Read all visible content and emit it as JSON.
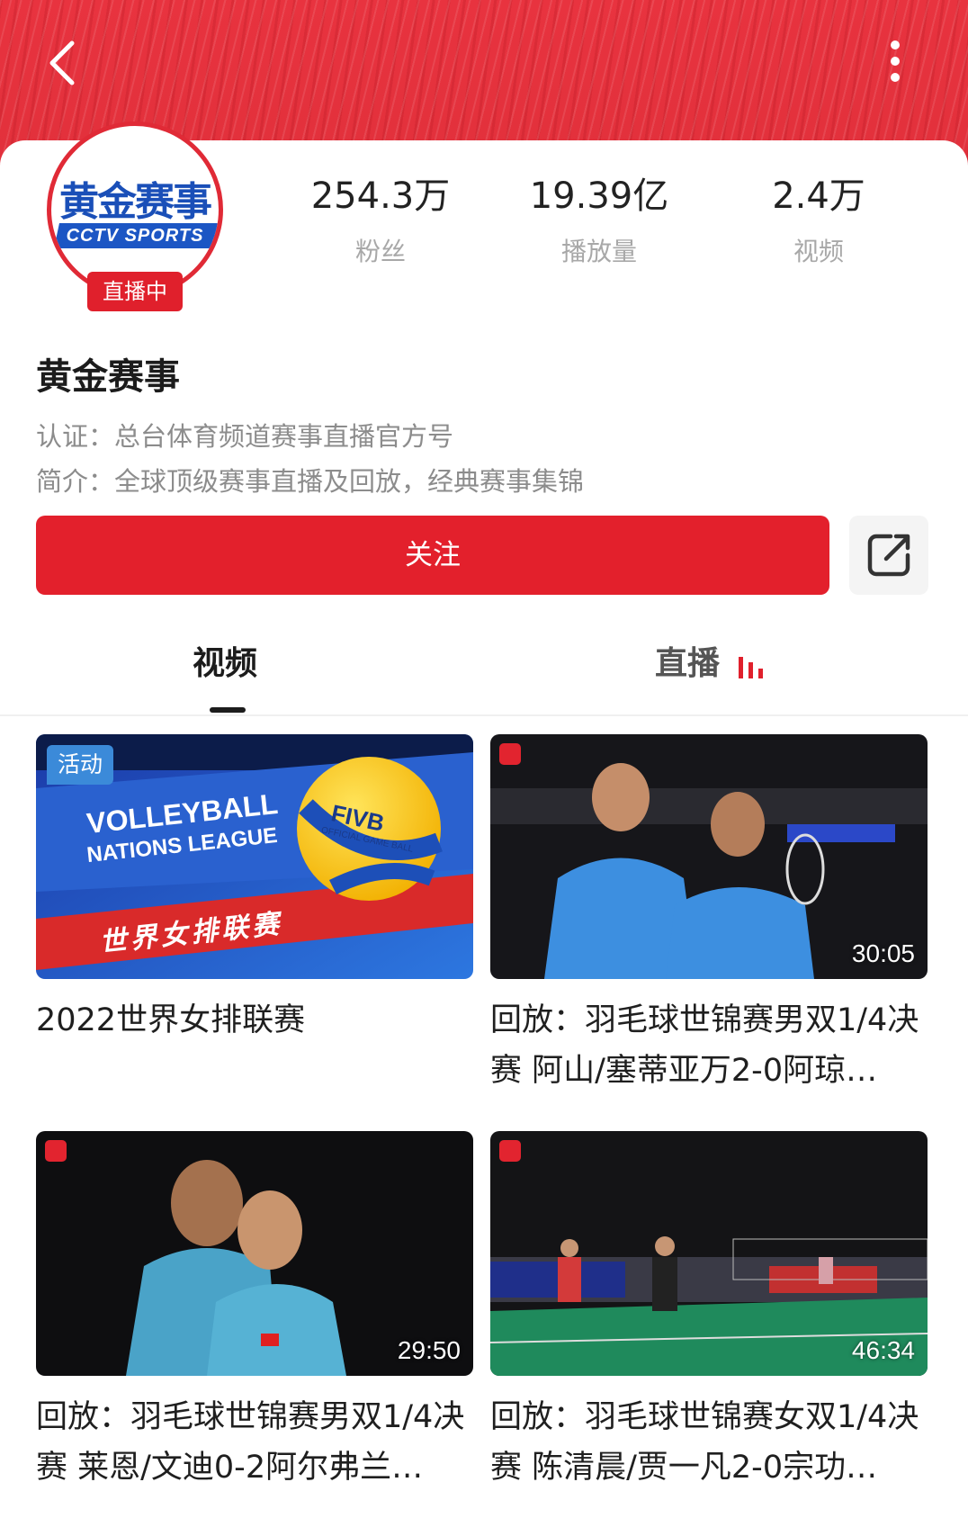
{
  "header": {
    "back_icon": "chevron-left-icon",
    "more_icon": "vertical-dots-icon",
    "accent": "#e0202c"
  },
  "channel": {
    "logo_text_top": "黄金赛事",
    "logo_text_bottom": "CCTV SPORTS",
    "live_badge": "直播中",
    "name": "黄金赛事",
    "certification": "认证：总台体育频道赛事直播官方号",
    "intro": "简介：全球顶级赛事直播及回放，经典赛事集锦"
  },
  "stats": [
    {
      "value": "254.3万",
      "label": "粉丝"
    },
    {
      "value": "19.39亿",
      "label": "播放量"
    },
    {
      "value": "2.4万",
      "label": "视频"
    }
  ],
  "actions": {
    "follow_label": "关注",
    "share_icon": "share-out-icon"
  },
  "tabs": [
    {
      "label": "视频",
      "active": true
    },
    {
      "label": "直播",
      "active": false,
      "icon": "live-bars-icon"
    }
  ],
  "videos": [
    {
      "title": "2022世界女排联赛",
      "tag": "活动",
      "duration": "",
      "thumb_text": {
        "line1": "VOLLEYBALL",
        "line2": "NATIONS LEAGUE",
        "ball": "FIVB",
        "ball_sub": "OFFICIAL GAME BALL",
        "banner": "世界女排联赛"
      }
    },
    {
      "title": "回放：羽毛球世锦赛男双1/4决赛 阿山/塞蒂亚万2-0阿琼…",
      "tag": "",
      "duration": "30:05"
    },
    {
      "title": "回放：羽毛球世锦赛男双1/4决赛 莱恩/文迪0-2阿尔弗兰…",
      "tag": "",
      "duration": "29:50"
    },
    {
      "title": "回放：羽毛球世锦赛女双1/4决赛 陈清晨/贾一凡2-0宗功…",
      "tag": "",
      "duration": "46:34"
    }
  ]
}
